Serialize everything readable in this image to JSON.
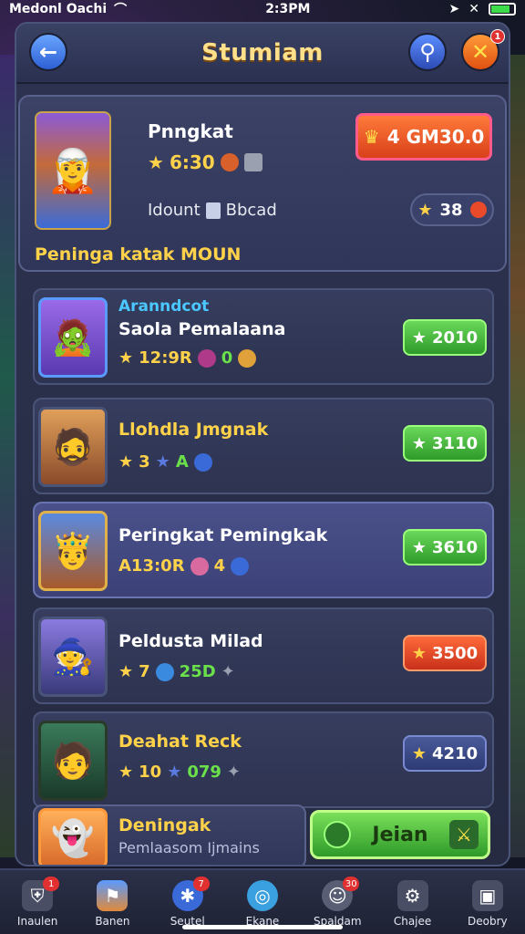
{
  "status_bar": {
    "carrier": "Medonl Oachi",
    "time": "2:3PM",
    "battery_level": 0.8
  },
  "header": {
    "title": "Stumiam",
    "close_badge": "1"
  },
  "featured": {
    "name": "Pnngkat",
    "stats": "6:30",
    "meta_label": "Idount",
    "meta_value": "Bbcad",
    "price": "4 GM30.0",
    "score": "38",
    "subtitle": "Peninga katak MOUN"
  },
  "list": [
    {
      "label_top": "Aranndcot",
      "name": "Saola Pemalaana",
      "stats": "12:9R",
      "stat_extra": "0",
      "button": "2010",
      "button_style": "green",
      "avatar_color": "#7a4ad8"
    },
    {
      "label_top": "",
      "name": "Llohdla Jmgnak",
      "stats": "3",
      "stat_extra": "A",
      "button": "3110",
      "button_style": "green",
      "avatar_color": "#c8783a"
    },
    {
      "label_top": "",
      "name": "Peringkat Pemingkak",
      "stats": "A13:0R",
      "stat_extra": "4",
      "button": "3610",
      "button_style": "green",
      "avatar_color": "#4a6ac8"
    },
    {
      "label_top": "",
      "name": "Peldusta Milad",
      "stats": "7",
      "stat_extra": "25D",
      "button": "3500",
      "button_style": "red",
      "avatar_color": "#5a4aa8"
    },
    {
      "label_top": "",
      "name": "Deahat Reck",
      "stats": "10",
      "stat_extra": "079",
      "button": "4210",
      "button_style": "blue",
      "avatar_color": "#2a6a5a"
    }
  ],
  "partial": {
    "name": "Deningak",
    "sub": "Pemlaasom Ijmains"
  },
  "join_button": "Jeian",
  "nav": [
    {
      "label": "Inaulen",
      "badge": "1",
      "icon": "shield-icon"
    },
    {
      "label": "Banen",
      "badge": "",
      "icon": "banner-icon"
    },
    {
      "label": "Seutel",
      "badge": "7",
      "icon": "social-icon"
    },
    {
      "label": "Ekane",
      "badge": "",
      "icon": "arena-icon"
    },
    {
      "label": "Spaldam",
      "badge": "30",
      "icon": "mask-icon"
    },
    {
      "label": "Chajee",
      "badge": "",
      "icon": "gear-icon"
    },
    {
      "label": "Deobry",
      "badge": "",
      "icon": "chest-icon"
    }
  ]
}
